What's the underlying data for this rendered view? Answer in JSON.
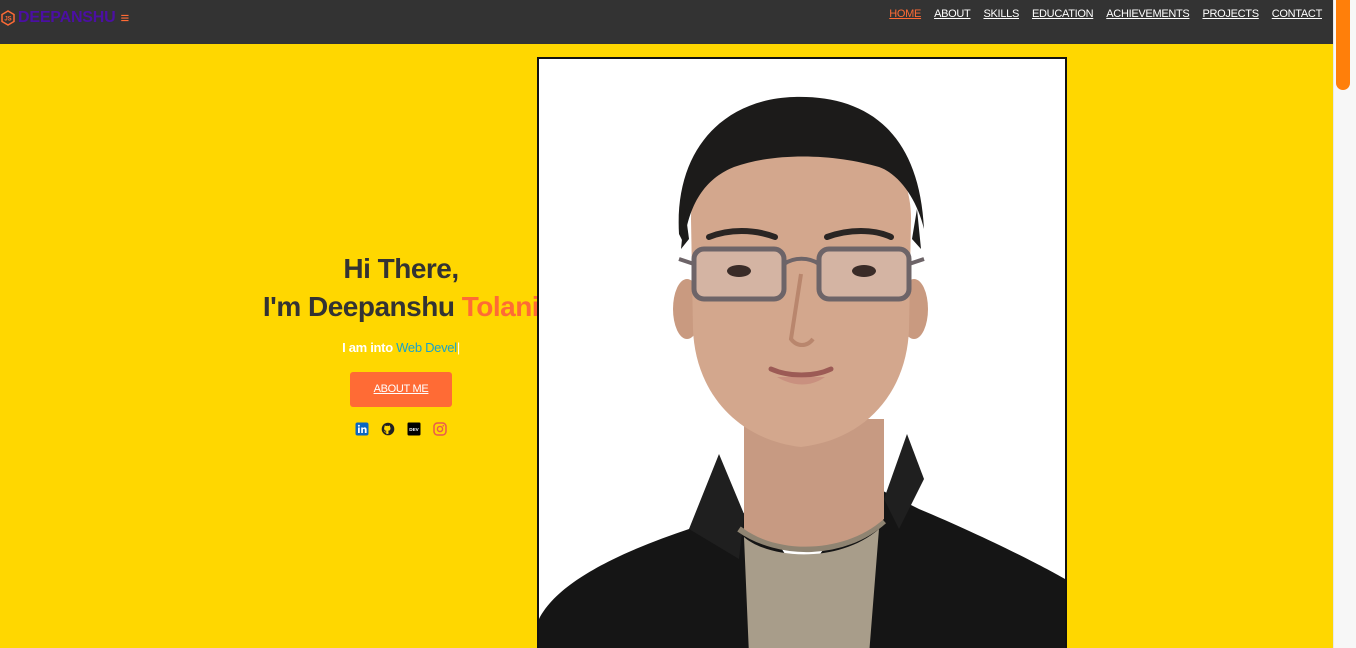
{
  "navbar": {
    "brand": "DEEPANSHU",
    "brand_logo": "js-hexagon-logo",
    "menu_icon": "hamburger-icon",
    "links": [
      {
        "label": "HOME",
        "active": true
      },
      {
        "label": "ABOUT"
      },
      {
        "label": "SKILLS"
      },
      {
        "label": "EDUCATION"
      },
      {
        "label": "ACHIEVEMENTS"
      },
      {
        "label": "PROJECTS"
      },
      {
        "label": "CONTACT"
      }
    ]
  },
  "hero": {
    "greeting_line1": "Hi There,",
    "greeting_prefix": "I'm Deepanshu ",
    "greeting_highlight": "Tolani",
    "typed_prefix": "I am into ",
    "typed_text": "Web Devel",
    "typed_cursor": "|",
    "cta_label": "ABOUT ME",
    "socials": [
      "linkedin-icon",
      "github-icon",
      "dev-icon",
      "instagram-icon"
    ]
  },
  "colors": {
    "background": "#ffd700",
    "navbar": "#333333",
    "accent": "#ff6b35",
    "brand_text": "#4b0fa3",
    "typed_text": "#1aa3c8"
  }
}
